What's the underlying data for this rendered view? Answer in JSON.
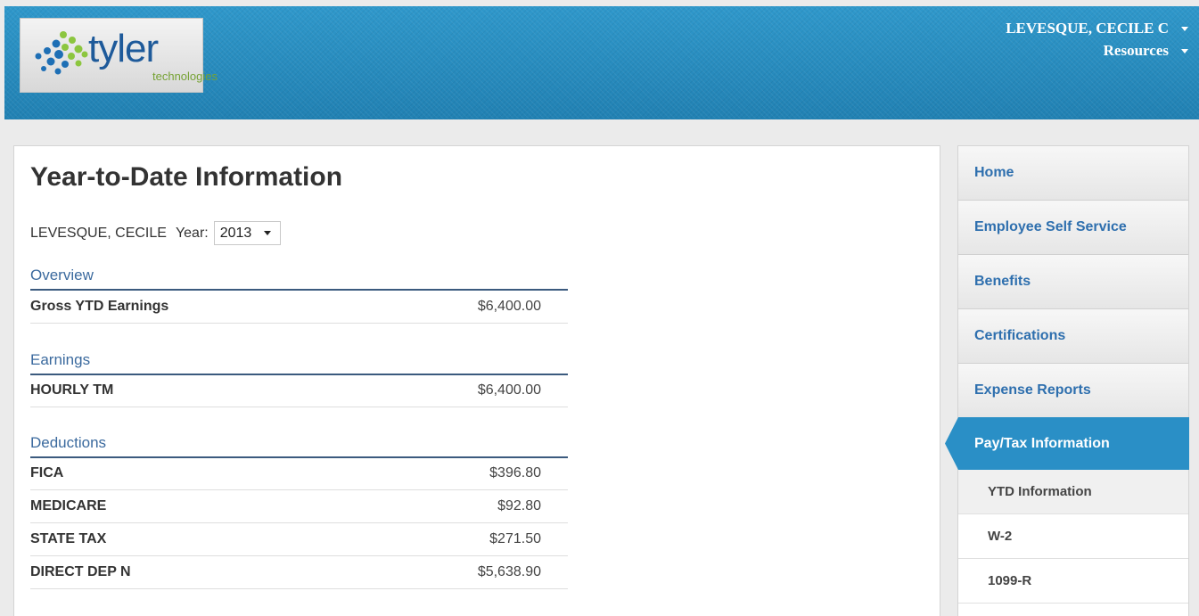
{
  "header": {
    "logo_word": "tyler",
    "logo_sub": "technologies",
    "user_menu": [
      {
        "label": "LEVESQUE, CECILE C"
      },
      {
        "label": "Resources"
      }
    ]
  },
  "main": {
    "title": "Year-to-Date Information",
    "employee_name": "LEVESQUE, CECILE",
    "year_label": "Year:",
    "year_value": "2013",
    "sections": [
      {
        "heading": "Overview",
        "rows": [
          {
            "label": "Gross YTD Earnings",
            "amount": "$6,400.00"
          }
        ]
      },
      {
        "heading": "Earnings",
        "rows": [
          {
            "label": "HOURLY TM",
            "amount": "$6,400.00"
          }
        ]
      },
      {
        "heading": "Deductions",
        "rows": [
          {
            "label": "FICA",
            "amount": "$396.80"
          },
          {
            "label": "MEDICARE",
            "amount": "$92.80"
          },
          {
            "label": "STATE TAX",
            "amount": "$271.50"
          },
          {
            "label": "DIRECT DEP N",
            "amount": "$5,638.90"
          }
        ]
      }
    ]
  },
  "sidebar": {
    "items": [
      {
        "label": "Home"
      },
      {
        "label": "Employee Self Service"
      },
      {
        "label": "Benefits"
      },
      {
        "label": "Certifications"
      },
      {
        "label": "Expense Reports"
      }
    ],
    "active": {
      "label": "Pay/Tax Information"
    },
    "sub_items": [
      {
        "label": "YTD Information"
      },
      {
        "label": "W-2"
      },
      {
        "label": "1099-R"
      }
    ]
  },
  "colors": {
    "header_blue": "#2a8dbf",
    "link_blue": "#2e6fae",
    "section_blue": "#3b6a9e",
    "active_nav": "#2a8fc6"
  }
}
